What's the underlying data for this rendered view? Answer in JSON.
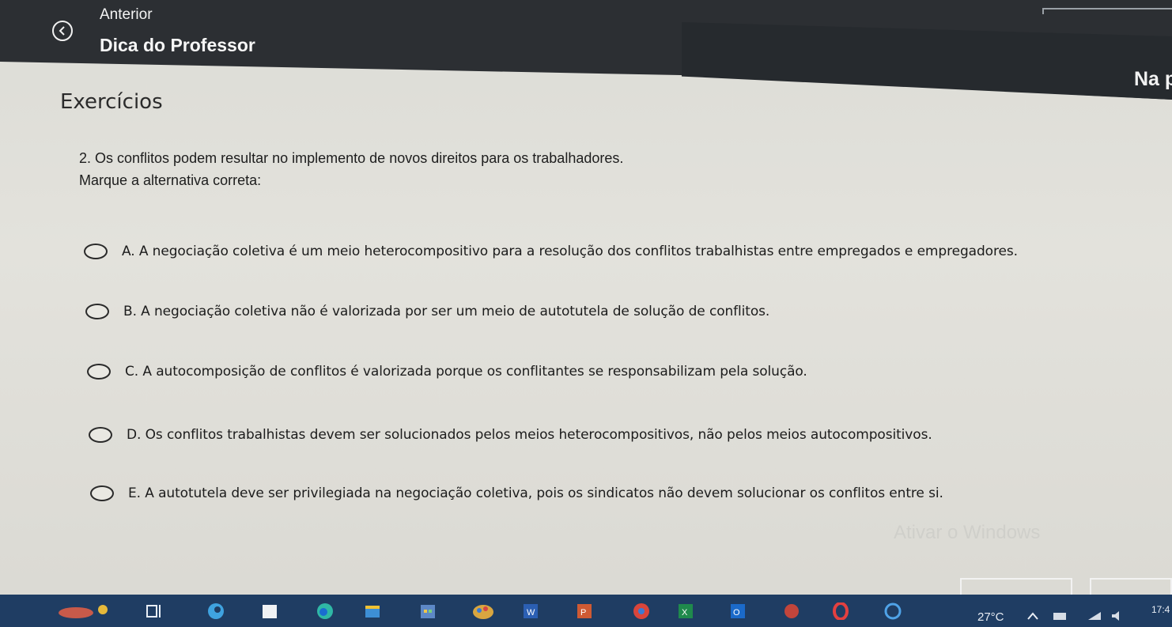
{
  "header": {
    "previous_label": "Anterior",
    "title": "Dica do Professor",
    "right_peek": "Na p"
  },
  "section_title": "Exercícios",
  "question": {
    "text": "2. Os conflitos podem resultar no implemento de novos direitos para os trabalhadores.",
    "instruction": "Marque a alternativa correta:"
  },
  "options": [
    {
      "label": "A. A negociação coletiva é um meio heterocompositivo para a resolução dos conflitos trabalhistas entre empregados e empregadores."
    },
    {
      "label": "B. A negociação coletiva não é valorizada por ser um meio de autotutela de solução de conflitos."
    },
    {
      "label": "C. A autocomposição de conflitos é valorizada porque os conflitantes se responsabilizam pela solução."
    },
    {
      "label": "D. Os conflitos trabalhistas devem ser solucionados pelos meios heterocompositivos, não pelos meios autocompositivos."
    },
    {
      "label": "E. A autotutela deve ser privilegiada na negociação coletiva, pois os sindicatos não devem solucionar os conflitos entre si."
    }
  ],
  "watermark": "Ativar o Windows",
  "taskbar": {
    "weather": "27°C",
    "clock": "17:4",
    "icons": [
      "weather-icon",
      "task-view-icon",
      "edge-icon",
      "file-explorer-icon",
      "edge-browser-icon",
      "store-icon",
      "calendar-icon",
      "paint-icon",
      "word-icon",
      "powerpoint-icon",
      "chrome-icon",
      "excel-icon",
      "outlook-icon",
      "app-icon",
      "opera-icon",
      "circle-app-icon"
    ]
  },
  "colors": {
    "header_bg": "#2c2f33",
    "page_bg": "#e0dfd9",
    "taskbar_bg": "#1f3d63"
  }
}
